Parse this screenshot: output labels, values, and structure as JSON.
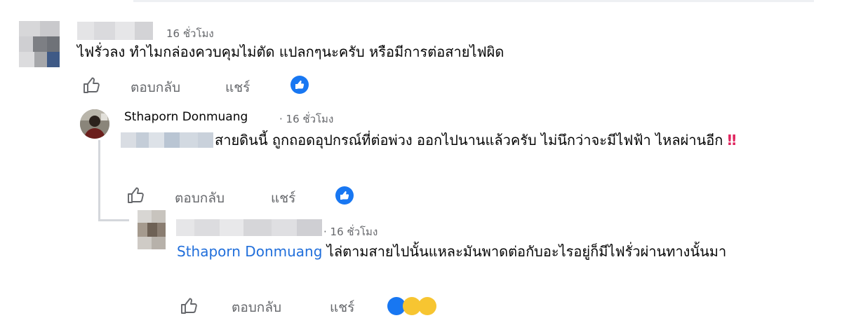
{
  "comments": [
    {
      "time": "16 ชั่วโมง",
      "text": "ไฟรั่วลง ทำไมกล่องควบคุมไม่ตัด แปลกๆนะครับ หรือมีการต่อสายไฟผิด",
      "reply_label": "ตอบกลับ",
      "share_label": "แชร์"
    },
    {
      "author": "Sthaporn Donmuang",
      "time": "· 16 ชั่วโมง",
      "text": "สายดินนี้ ถูกถอดอุปกรณ์ที่ต่อพ่วง ออกไปนานแล้วครับ ไม่นึกว่าจะมีไฟฟ้า ไหลผ่านอีก",
      "emoji": "‼",
      "reply_label": "ตอบกลับ",
      "share_label": "แชร์"
    },
    {
      "time": "· 16 ชั่วโมง",
      "mention": "Sthaporn Donmuang",
      "text": " ไล่ตามสายไปนั้นแหละมันพาดต่อกับอะไรอยู่ก็มีไฟรั่วผ่านทางนั้นมา",
      "reply_label": "ตอบกลับ",
      "share_label": "แชร์"
    }
  ],
  "colors": {
    "mention": "#216fdb",
    "reaction": "#1877f2",
    "meta": "#65676b",
    "thread_line": "#d4d7dc"
  },
  "icons": [
    "thumbs-up-icon",
    "like-reaction-icon",
    "laugh-reaction-icon"
  ]
}
